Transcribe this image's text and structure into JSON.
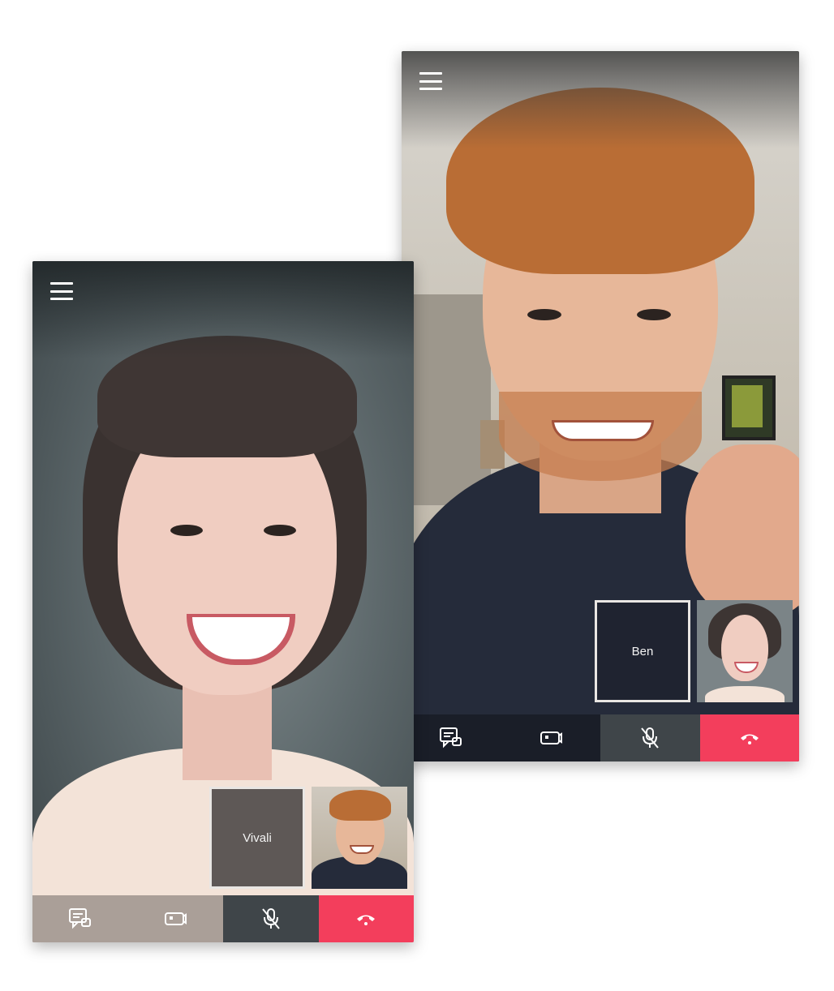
{
  "left_screen": {
    "thumbnail_name": "Vivali",
    "controls": [
      "chat-icon",
      "camera-icon",
      "mic-muted-icon",
      "hang-up-icon"
    ]
  },
  "right_screen": {
    "thumbnail_name": "Ben",
    "controls": [
      "chat-icon",
      "camera-icon",
      "mic-muted-icon",
      "hang-up-icon"
    ]
  },
  "colors": {
    "end_call": "#f33e5c",
    "mic_button": "#3f4549",
    "icon": "#ffffff"
  }
}
